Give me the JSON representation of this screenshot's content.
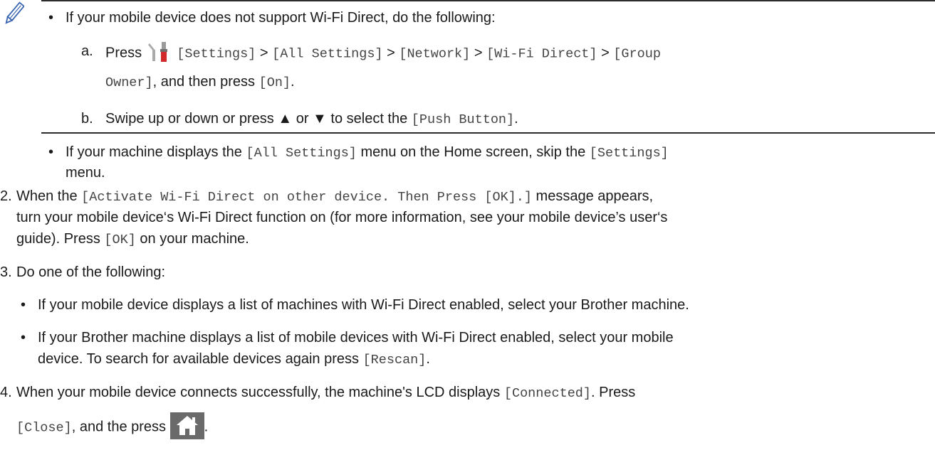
{
  "note": {
    "bullet_1": {
      "bullet": "•",
      "text": "If your mobile device does not support Wi-Fi Direct, do the following:",
      "step_a": {
        "marker": "a.",
        "press": "Press",
        "settings": "[Settings]",
        "sep": ">",
        "all_settings": "[All Settings]",
        "network": "[Network]",
        "wifi_direct": "[Wi-Fi Direct]",
        "group": "[Group",
        "owner": "Owner]",
        "and_then": ", and then press",
        "on": "[On]",
        "period": "."
      },
      "step_b": {
        "marker": "b.",
        "text_1": "Swipe up or down or press ▲ or ▼ to select the",
        "push_button": "[Push Button]",
        "period": "."
      }
    },
    "bullet_2": {
      "bullet": "•",
      "text_1": "If your machine displays the",
      "all_settings": "[All Settings]",
      "text_2": "menu on the Home screen, skip the",
      "settings": "[Settings]",
      "text_3": "menu."
    }
  },
  "step2": {
    "number": "2.",
    "text_1": "When the",
    "message": "[Activate Wi-Fi Direct on other device. Then Press [OK].]",
    "text_2": "message appears,",
    "line2": "turn your mobile device‘s Wi-Fi Direct function on (for more information, see your mobile device’s user‘s",
    "line3_a": "guide). Press",
    "ok": "[OK]",
    "line3_b": "on your machine."
  },
  "step3": {
    "number": "3.",
    "text": "Do one of the following:",
    "bullet_a": "If your mobile device displays a list of machines with Wi-Fi Direct enabled, select your Brother machine.",
    "bullet_b_1": "If your Brother machine displays a list of mobile devices with Wi-Fi Direct enabled, select your mobile",
    "bullet_b_2": "device. To search for available devices again press",
    "rescan": "[Rescan]",
    "period": ".",
    "bullet": "•"
  },
  "step4": {
    "number": "4.",
    "text_1": "When your mobile device connects successfully, the machine's LCD displays",
    "connected": "[Connected]",
    "text_2": ". Press",
    "close": "[Close]",
    "text_3": ", and the press",
    "period": "."
  },
  "icons": {
    "note_icon": "pencil-icon",
    "settings_icon": "settings-tools-icon",
    "home_icon": "home-icon"
  }
}
